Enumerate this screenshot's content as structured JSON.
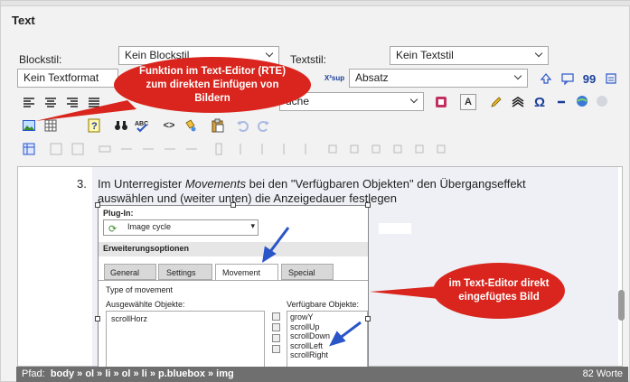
{
  "section": {
    "title": "Text"
  },
  "form": {
    "blockstil_label": "Blockstil:",
    "blockstil_value": "Kein Blockstil",
    "textstil_label": "Textstil:",
    "textstil_value": "Kein Textstil",
    "textformat_value": "Kein Textformat",
    "paragraph_value": "Absatz",
    "search_value": "uche"
  },
  "toolbar": {
    "sup_label": "X²sup",
    "abbr_label": "A",
    "omega_label": "Ω",
    "quote_label": "99",
    "code_label": "<>"
  },
  "editor": {
    "step_number": "3.",
    "step_text_before": "Im Unterregister ",
    "step_text_em": "Movements",
    "step_text_after": " bei den \"Verfügbaren Objekten\" den Übergangseffekt auswählen und (weiter unten) die Anzeigedauer festlegen"
  },
  "embedded": {
    "plugin_label": "Plug-In:",
    "plugin_value": "Image cycle",
    "options_label": "Erweiterungsoptionen",
    "tabs": [
      "General",
      "Settings",
      "Movement",
      "Special"
    ],
    "type_label": "Type of movement",
    "selected_label": "Ausgewählte Objekte:",
    "available_label": "Verfügbare Objekte:",
    "selected_items": [
      "scrollHorz"
    ],
    "available_items": [
      "growY",
      "scrollUp",
      "scrollDown",
      "scrollLeft",
      "scrollRight"
    ]
  },
  "status": {
    "path_label": "Pfad:",
    "path": "body » ol » li » ol » li » p.bluebox » img",
    "word_count": "82 Worte"
  },
  "callouts": {
    "rte_image": "Funktion im Text-Editor (RTE) zum direkten Einfügen von Bildern",
    "inserted_image": "im Text-Editor direkt eingefügtes Bild"
  },
  "colors": {
    "callout": "#d9251d",
    "arrow": "#2a55c9",
    "status": "#6f6f6f"
  }
}
